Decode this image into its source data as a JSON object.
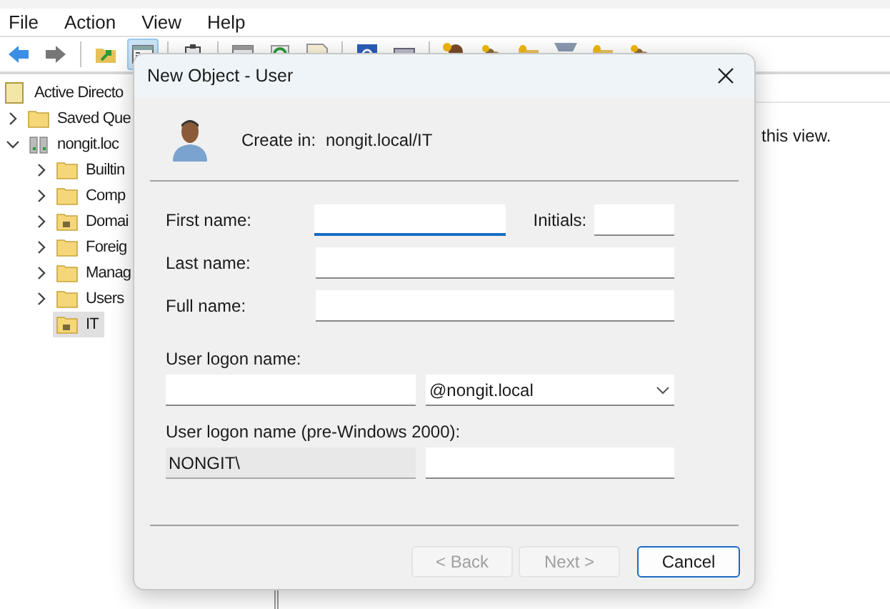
{
  "menu": [
    "File",
    "Action",
    "View",
    "Help"
  ],
  "toolbar": [
    {
      "kind": "button",
      "selected": false
    },
    {
      "kind": "button",
      "selected": false
    },
    {
      "kind": "separator"
    },
    {
      "kind": "button",
      "selected": false
    },
    {
      "kind": "button",
      "selected": true
    },
    {
      "kind": "separator"
    },
    {
      "kind": "button",
      "selected": false
    },
    {
      "kind": "separator"
    },
    {
      "kind": "button",
      "selected": false
    },
    {
      "kind": "button",
      "selected": false
    },
    {
      "kind": "button",
      "selected": false
    },
    {
      "kind": "separator"
    },
    {
      "kind": "button",
      "selected": false
    },
    {
      "kind": "button",
      "selected": false
    },
    {
      "kind": "separator"
    },
    {
      "kind": "button",
      "selected": false
    },
    {
      "kind": "button",
      "selected": false
    },
    {
      "kind": "button",
      "selected": false
    },
    {
      "kind": "button",
      "selected": false
    },
    {
      "kind": "button",
      "selected": false
    },
    {
      "kind": "button",
      "selected": false
    }
  ],
  "tree": [
    {
      "label": "Active Directo",
      "kind": "root",
      "selected": false,
      "children": [
        {
          "label": "Saved Que",
          "kind": "folder",
          "expanded": false,
          "selected": false
        },
        {
          "label": "nongit.loc",
          "kind": "domain",
          "expanded": true,
          "selected": false,
          "children": [
            {
              "label": "Builtin",
              "kind": "folder",
              "expanded": false,
              "selected": false
            },
            {
              "label": "Comp",
              "kind": "folder",
              "expanded": false,
              "selected": false
            },
            {
              "label": "Domai",
              "kind": "ou",
              "expanded": false,
              "selected": false
            },
            {
              "label": "Foreig",
              "kind": "folder",
              "expanded": false,
              "selected": false
            },
            {
              "label": "Manag",
              "kind": "folder",
              "expanded": false,
              "selected": false
            },
            {
              "label": "Users",
              "kind": "folder",
              "expanded": false,
              "selected": false
            },
            {
              "label": "IT",
              "kind": "ou",
              "selected": true
            }
          ]
        }
      ]
    }
  ],
  "content": {
    "message": "this view."
  },
  "dialog": {
    "title": "New Object - User",
    "create_in_label": "Create in:",
    "create_in_value": "nongit.local/IT",
    "first_name": {
      "label": "First name:",
      "focused": true
    },
    "initials": {
      "label": "Initials:",
      "focused": false
    },
    "last_name": {
      "label": "Last name:",
      "focused": false
    },
    "full_name": {
      "label": "Full name:",
      "focused": false
    },
    "logon": {
      "label": "User logon name:",
      "focused": false,
      "domain": "@nongit.local"
    },
    "pre2000": {
      "label": "User logon name (pre-Windows 2000):",
      "prefix": "NONGIT\\",
      "focused": false
    },
    "buttons": [
      {
        "label": "< Back",
        "disabled": true,
        "default": false
      },
      {
        "label": "Next >",
        "disabled": true,
        "default": false
      },
      {
        "label": "Cancel",
        "disabled": false,
        "default": true
      }
    ]
  }
}
